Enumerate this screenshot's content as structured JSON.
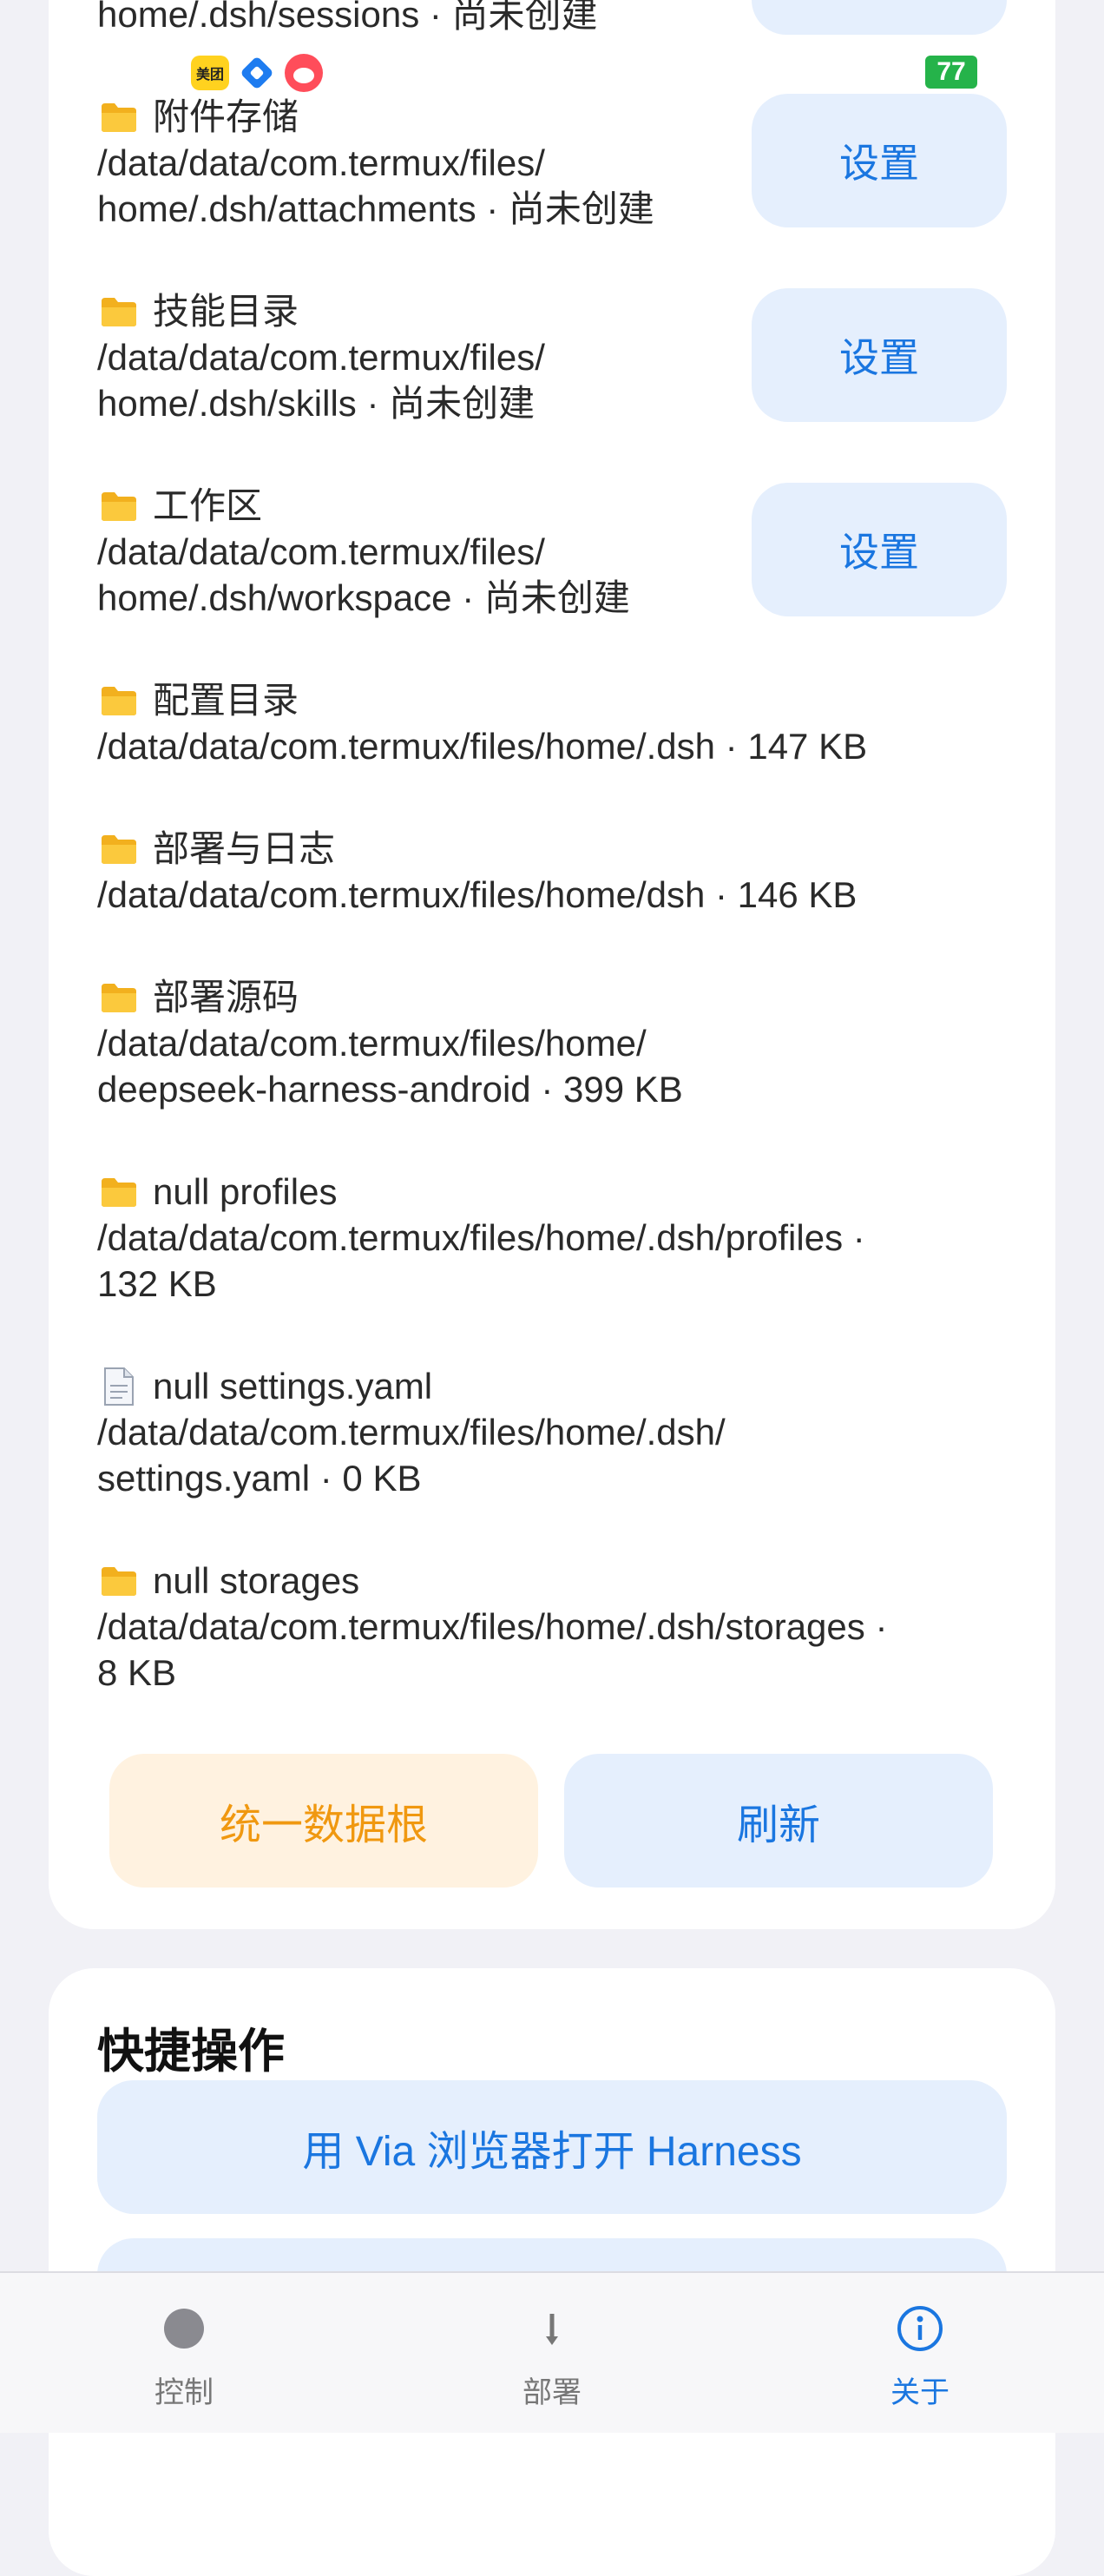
{
  "status_bar": {
    "battery": "77",
    "meituan_badge": "美团"
  },
  "storage": {
    "partial_top": "home/.dsh/sessions · 尚未创建",
    "entries": [
      {
        "icon": "folder",
        "name": "附件存储",
        "path": "/data/data/com.termux/files/\nhome/.dsh/attachments · 尚未创建",
        "action": "设置"
      },
      {
        "icon": "folder",
        "name": "技能目录",
        "path": "/data/data/com.termux/files/\nhome/.dsh/skills · 尚未创建",
        "action": "设置"
      },
      {
        "icon": "folder",
        "name": "工作区",
        "path": "/data/data/com.termux/files/\nhome/.dsh/workspace · 尚未创建",
        "action": "设置"
      },
      {
        "icon": "folder",
        "name": "配置目录",
        "path": "/data/data/com.termux/files/home/.dsh · 147 KB"
      },
      {
        "icon": "folder",
        "name": "部署与日志",
        "path": "/data/data/com.termux/files/home/dsh · 146 KB"
      },
      {
        "icon": "folder",
        "name": "部署源码",
        "path": "/data/data/com.termux/files/home/\ndeepseek-harness-android · 399 KB"
      },
      {
        "icon": "folder",
        "name": "null  profiles",
        "path": "/data/data/com.termux/files/home/.dsh/profiles ·\n132 KB"
      },
      {
        "icon": "file",
        "name": "null  settings.yaml",
        "path": "/data/data/com.termux/files/home/.dsh/\nsettings.yaml · 0 KB"
      },
      {
        "icon": "folder",
        "name": "null  storages",
        "path": "/data/data/com.termux/files/home/.dsh/storages ·\n8 KB"
      }
    ],
    "unify_button": "统一数据根",
    "refresh_button": "刷新"
  },
  "quick_actions": {
    "title": "快捷操作",
    "open_via_button": "用 Via 浏览器打开 Harness"
  },
  "bottom_nav": {
    "items": [
      {
        "label": "控制",
        "icon": "record-icon"
      },
      {
        "label": "部署",
        "icon": "download-arrow-icon"
      },
      {
        "label": "关于",
        "icon": "info-icon"
      }
    ]
  }
}
